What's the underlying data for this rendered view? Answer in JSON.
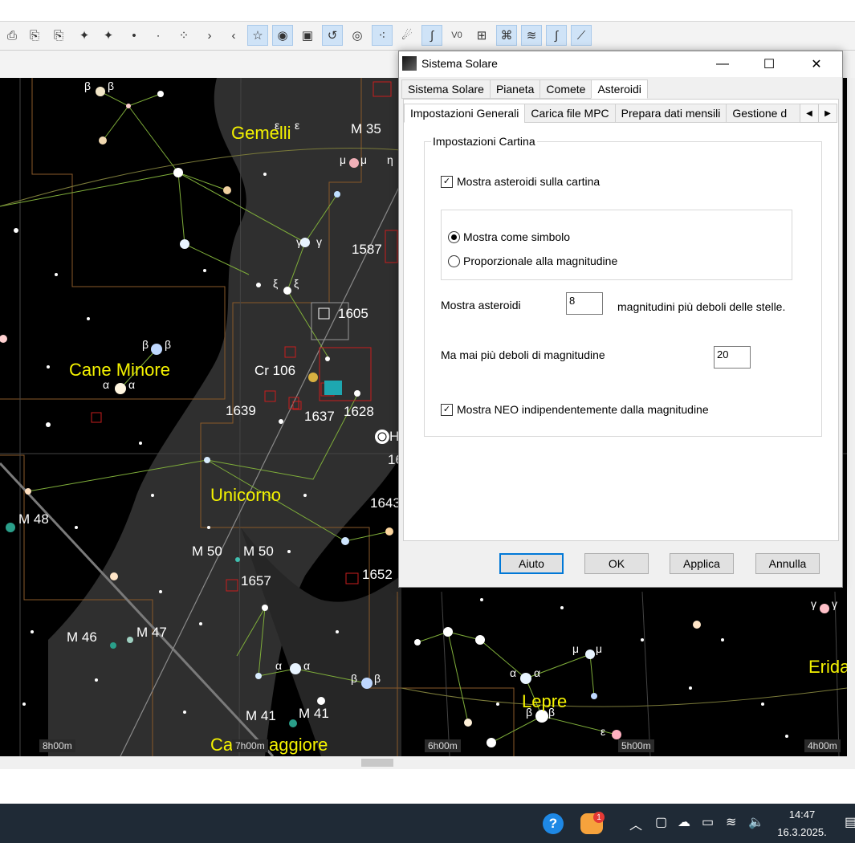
{
  "toolbar": {
    "v0_label": "V0"
  },
  "map": {
    "constellations": [
      "Gemelli",
      "Cane Minore",
      "Unicorno",
      "Lepre",
      "Erida",
      "Ca",
      "aggiore"
    ],
    "objects": [
      "M 35",
      "1587",
      "1605",
      "Cr 106",
      "1639",
      "1637",
      "1628",
      "M 48",
      "M 50",
      "M 50",
      "1657",
      "1652",
      "M 46",
      "M 47",
      "M 41",
      "M 41",
      "1643",
      "H",
      "16"
    ],
    "greek": [
      "β",
      "β",
      "ε",
      "ε",
      "μ",
      "μ",
      "η",
      "γ",
      "γ",
      "ξ",
      "ξ",
      "β",
      "β",
      "α",
      "α",
      "α",
      "α",
      "β",
      "β",
      "α",
      "α",
      "μ",
      "μ",
      "β",
      "β",
      "ε",
      "γ",
      "γ"
    ],
    "ra_labels": [
      "8h00m",
      "7h00m",
      "6h00m",
      "5h00m",
      "4h00m"
    ]
  },
  "dialog": {
    "title": "Sistema Solare",
    "tabs_top": [
      "Sistema Solare",
      "Pianeta",
      "Comete",
      "Asteroidi"
    ],
    "selected_top_tab": "Asteroidi",
    "tabs_sub": [
      "Impostazioni Generali",
      "Carica file MPC",
      "Prepara dati mensili",
      "Gestione d"
    ],
    "selected_sub_tab": "Impostazioni Generali",
    "group_title": "Impostazioni Cartina",
    "show_asteroids_label": "Mostra asteroidi sulla cartina",
    "show_asteroids_checked": true,
    "radio_symbol_label": "Mostra come simbolo",
    "radio_magnitude_label": "Proporzionale alla magnitudine",
    "radio_selected": "symbol",
    "show_asteroids_mag_label": "Mostra asteroidi",
    "show_asteroids_mag_value": "8",
    "mag_fainter_label": "magnitudini più deboli delle stelle.",
    "never_fainter_label": "Ma mai più deboli di magnitudine",
    "never_fainter_value": "20",
    "neo_label": "Mostra NEO indipendentemente dalla magnitudine",
    "neo_checked": true,
    "btn_help": "Aiuto",
    "btn_ok": "OK",
    "btn_apply": "Applica",
    "btn_cancel": "Annulla"
  },
  "taskbar": {
    "time": "14:47",
    "date": "16.3.2025.",
    "badge": "1"
  }
}
